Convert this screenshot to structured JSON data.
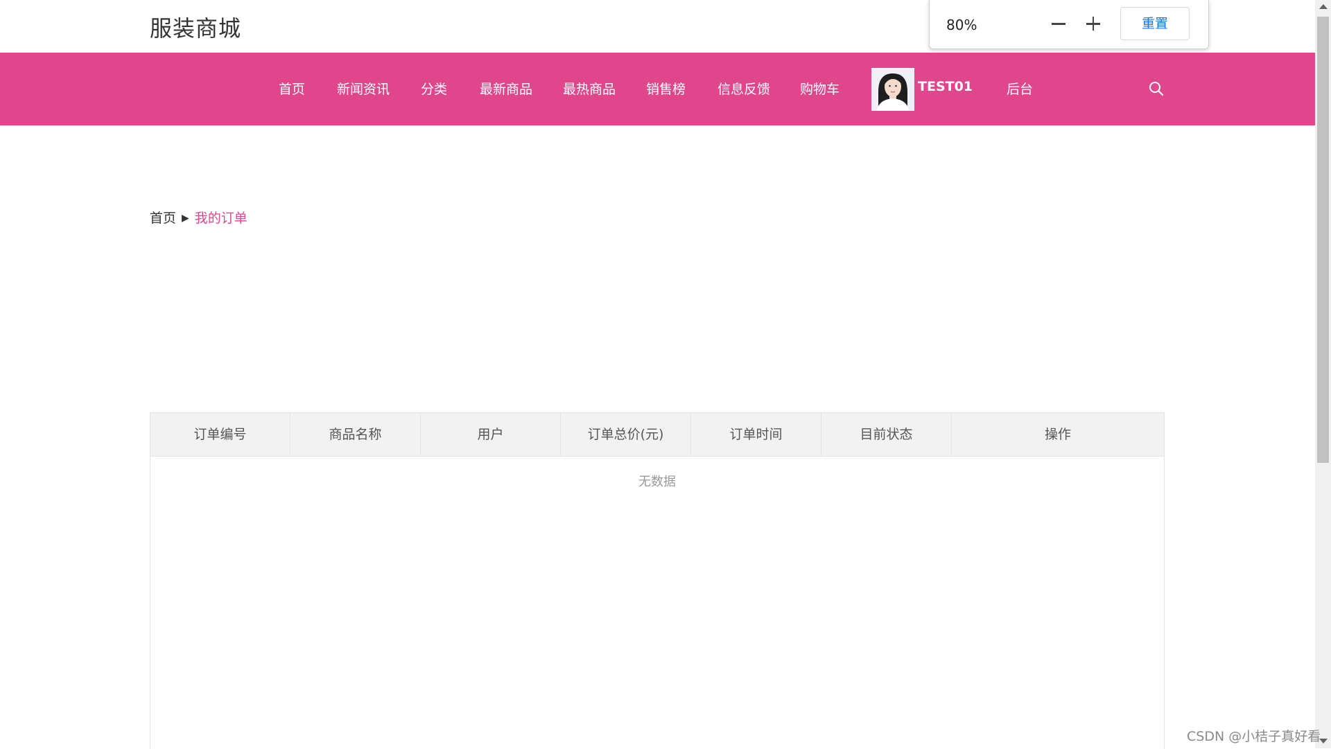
{
  "header": {
    "brand": "服装商城"
  },
  "zoom": {
    "value": "80%",
    "reset_label": "重置"
  },
  "nav": {
    "items": [
      "首页",
      "新闻资讯",
      "分类",
      "最新商品",
      "最热商品",
      "销售榜",
      "信息反馈",
      "购物车"
    ],
    "user": "TEST01",
    "admin": "后台",
    "color": "#e0468c"
  },
  "breadcrumb": {
    "home": "首页",
    "current": "我的订单"
  },
  "orders": {
    "columns": [
      "订单编号",
      "商品名称",
      "用户",
      "订单总价(元)",
      "订单时间",
      "目前状态",
      "操作"
    ],
    "empty_text": "无数据"
  },
  "watermark": "CSDN @小桔子真好看"
}
